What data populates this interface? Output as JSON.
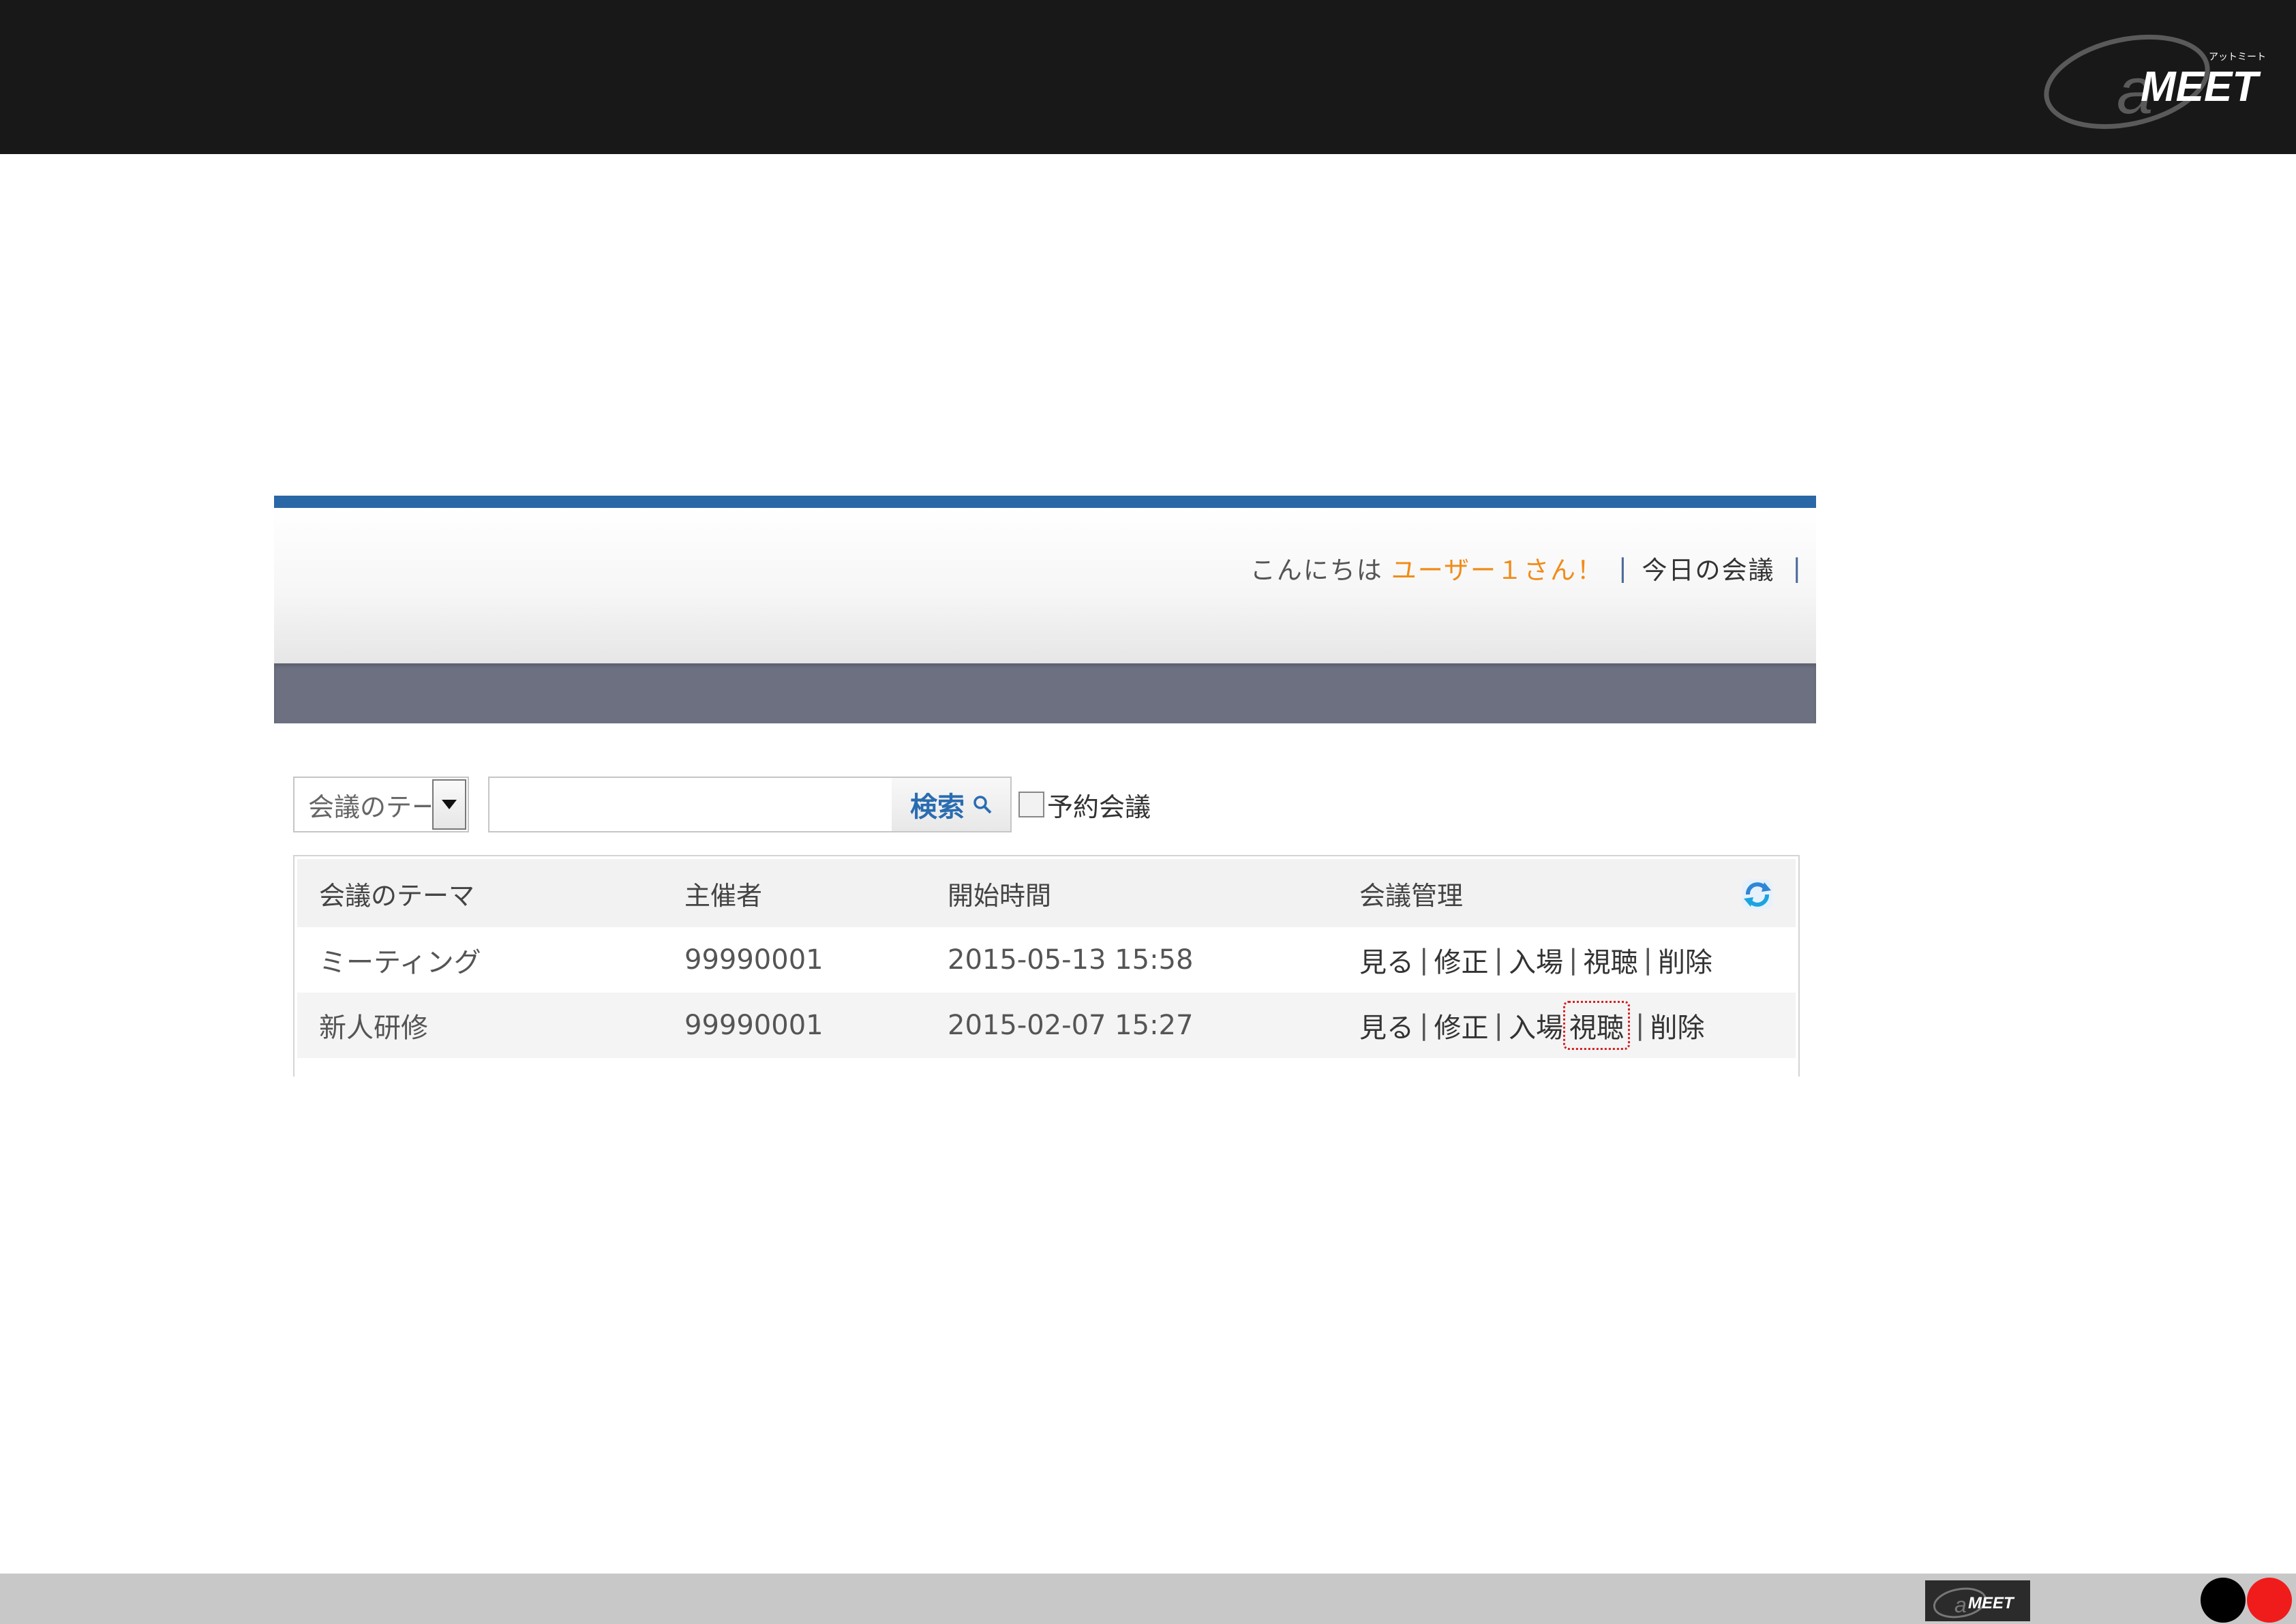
{
  "brand": {
    "logo_text": "@MEET",
    "logo_kana": "アットミート"
  },
  "header": {
    "greeting": "こんにちは",
    "user": "ユーザー１さん！",
    "separator": "|",
    "today_link": "今日の会議"
  },
  "search": {
    "select_value": "会議のテーマ",
    "input_value": "",
    "button_label": "検索",
    "reserved_label": "予約会議",
    "reserved_checked": false
  },
  "table": {
    "columns": [
      "会議のテーマ",
      "主催者",
      "開始時間",
      "会議管理"
    ],
    "rows": [
      {
        "theme": "ミーティング",
        "host": "99990001",
        "start": "2015-05-13 15:58"
      },
      {
        "theme": "新人研修",
        "host": "99990001",
        "start": "2015-02-07 15:27"
      }
    ],
    "actions": [
      "見る",
      "修正",
      "入場",
      "視聴",
      "削除"
    ],
    "action_separator": "|",
    "highlighted_action": "視聴"
  },
  "colors": {
    "accent_blue": "#2a67a6",
    "user_orange": "#f08c1a",
    "nav_gray": "#6c7081",
    "highlight_red": "#d42020"
  },
  "icons": {
    "dropdown": "chevron-down-icon",
    "search": "search-icon",
    "refresh": "refresh-icon"
  }
}
